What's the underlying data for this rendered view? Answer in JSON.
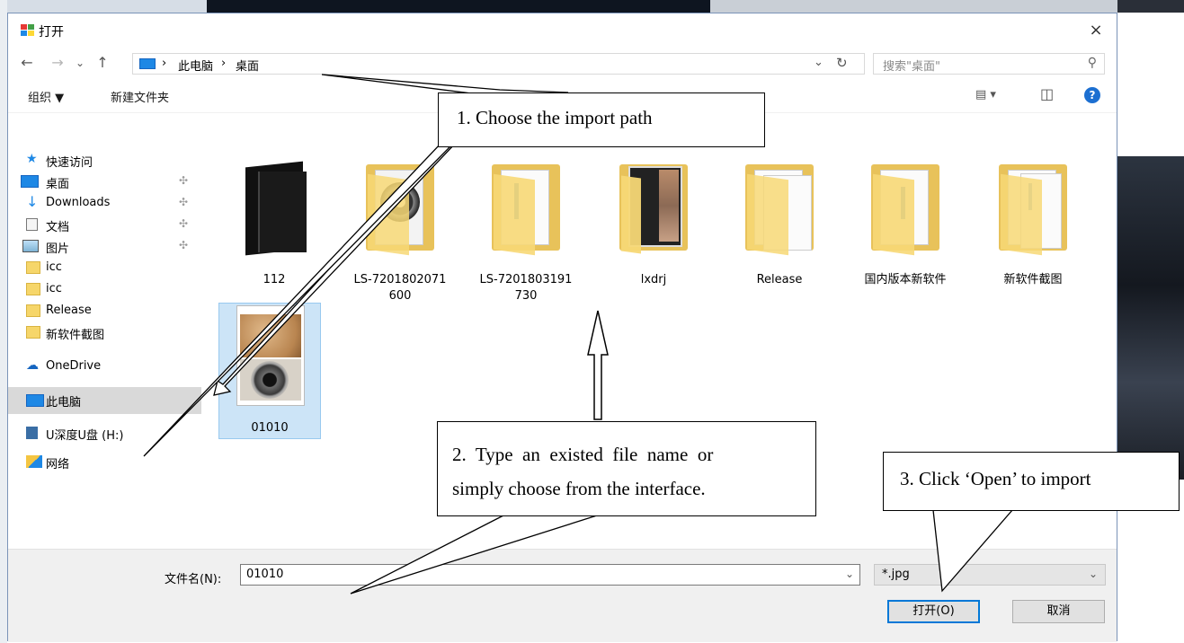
{
  "window": {
    "title": "打开",
    "close_glyph": "×"
  },
  "nav": {
    "back": "←",
    "forward": "→",
    "recent": "⌄",
    "up": "↑",
    "crumbs": [
      "›",
      "此电脑",
      "›",
      "桌面"
    ],
    "address_dropdown": "⌄",
    "refresh": "↻",
    "search_placeholder": "搜索\"桌面\"",
    "search_icon": "⚲"
  },
  "toolbar": {
    "organize": "组织 ▼",
    "new_folder": "新建文件夹",
    "view_glyph": "▤ ▾",
    "pane_glyph": "◫",
    "help": "?"
  },
  "sidebar": {
    "items": [
      {
        "label": "快速访问",
        "icon": "star-icon"
      },
      {
        "label": "桌面",
        "icon": "desktop-icon",
        "pinned": true
      },
      {
        "label": "Downloads",
        "icon": "download-arrow-icon",
        "pinned": true
      },
      {
        "label": "文档",
        "icon": "document-icon",
        "pinned": true
      },
      {
        "label": "图片",
        "icon": "picture-icon",
        "pinned": true
      },
      {
        "label": "icc",
        "icon": "folder-icon"
      },
      {
        "label": "icc",
        "icon": "folder-icon"
      },
      {
        "label": "Release",
        "icon": "folder-icon"
      },
      {
        "label": "新软件截图",
        "icon": "folder-icon"
      },
      {
        "label": "OneDrive",
        "icon": "cloud-icon"
      },
      {
        "label": "此电脑",
        "icon": "computer-icon",
        "selected": true
      },
      {
        "label": "U深度U盘 (H:)",
        "icon": "usb-drive-icon"
      },
      {
        "label": "网络",
        "icon": "network-icon"
      }
    ],
    "pin_glyph": "✣"
  },
  "files": [
    {
      "name": "112",
      "kind": "dark-folder"
    },
    {
      "name": "LS-7201802071\n600",
      "kind": "disc-folder"
    },
    {
      "name": "LS-7201803191\n730",
      "kind": "doc-folder"
    },
    {
      "name": "lxdrj",
      "kind": "book-folder"
    },
    {
      "name": "Release",
      "kind": "paper-folder"
    },
    {
      "name": "国内版本新软件",
      "kind": "doc-folder"
    },
    {
      "name": "新软件截图",
      "kind": "doc-folder"
    },
    {
      "name": "01010",
      "kind": "image",
      "selected": true
    }
  ],
  "bottom": {
    "filename_label": "文件名(N):",
    "filename_value": "01010",
    "filetype_value": "*.jpg",
    "dropdown_glyph": "⌄",
    "open_button": "打开(O)",
    "cancel_button": "取消"
  },
  "annotations": {
    "step1": "1.  Choose the import path",
    "step2_line1": "2.  Type  an  existed  file  name  or",
    "step2_line2": "simply choose from the interface.",
    "step3": "3.  Click ‘Open’ to import"
  },
  "colors": {
    "accent": "#0078d7",
    "selection": "#cce4f7",
    "folder": "#f6d66a",
    "help": "#1c6fd1"
  }
}
